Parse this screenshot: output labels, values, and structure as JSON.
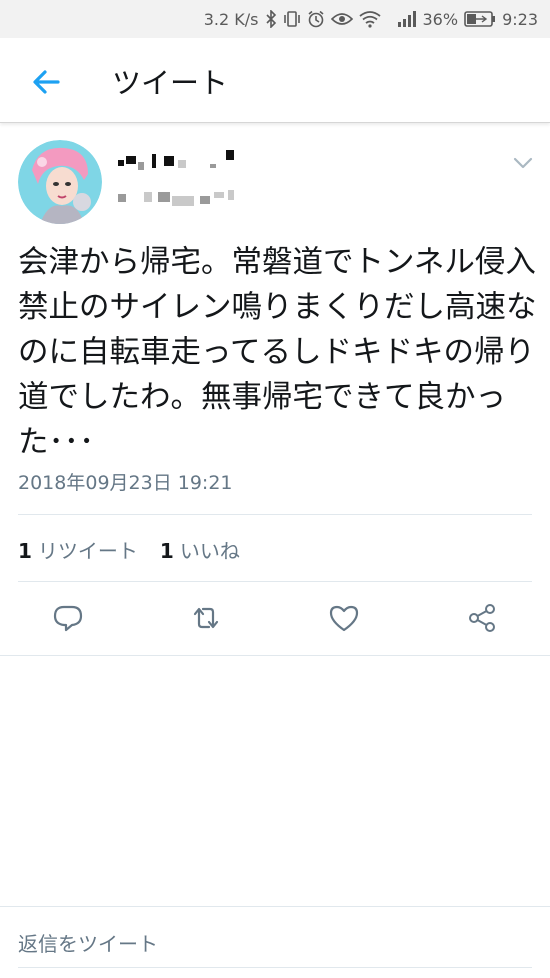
{
  "status_bar": {
    "speed": "3.2 K/s",
    "battery": "36%",
    "time": "9:23"
  },
  "header": {
    "title": "ツイート"
  },
  "tweet": {
    "text": "会津から帰宅。常磐道でトンネル侵入禁止のサイレン鳴りまくりだし高速なのに自転車走ってるしドキドキの帰り道でしたわ。無事帰宅できて良かった･･･",
    "timestamp": "2018年09月23日 19:21",
    "retweet_count": "1",
    "retweet_label": "リツイート",
    "like_count": "1",
    "like_label": "いいね"
  },
  "reply": {
    "placeholder": "返信をツイート"
  },
  "colors": {
    "accent": "#1da1f2",
    "secondary_text": "#657786",
    "icon": "#657786"
  }
}
